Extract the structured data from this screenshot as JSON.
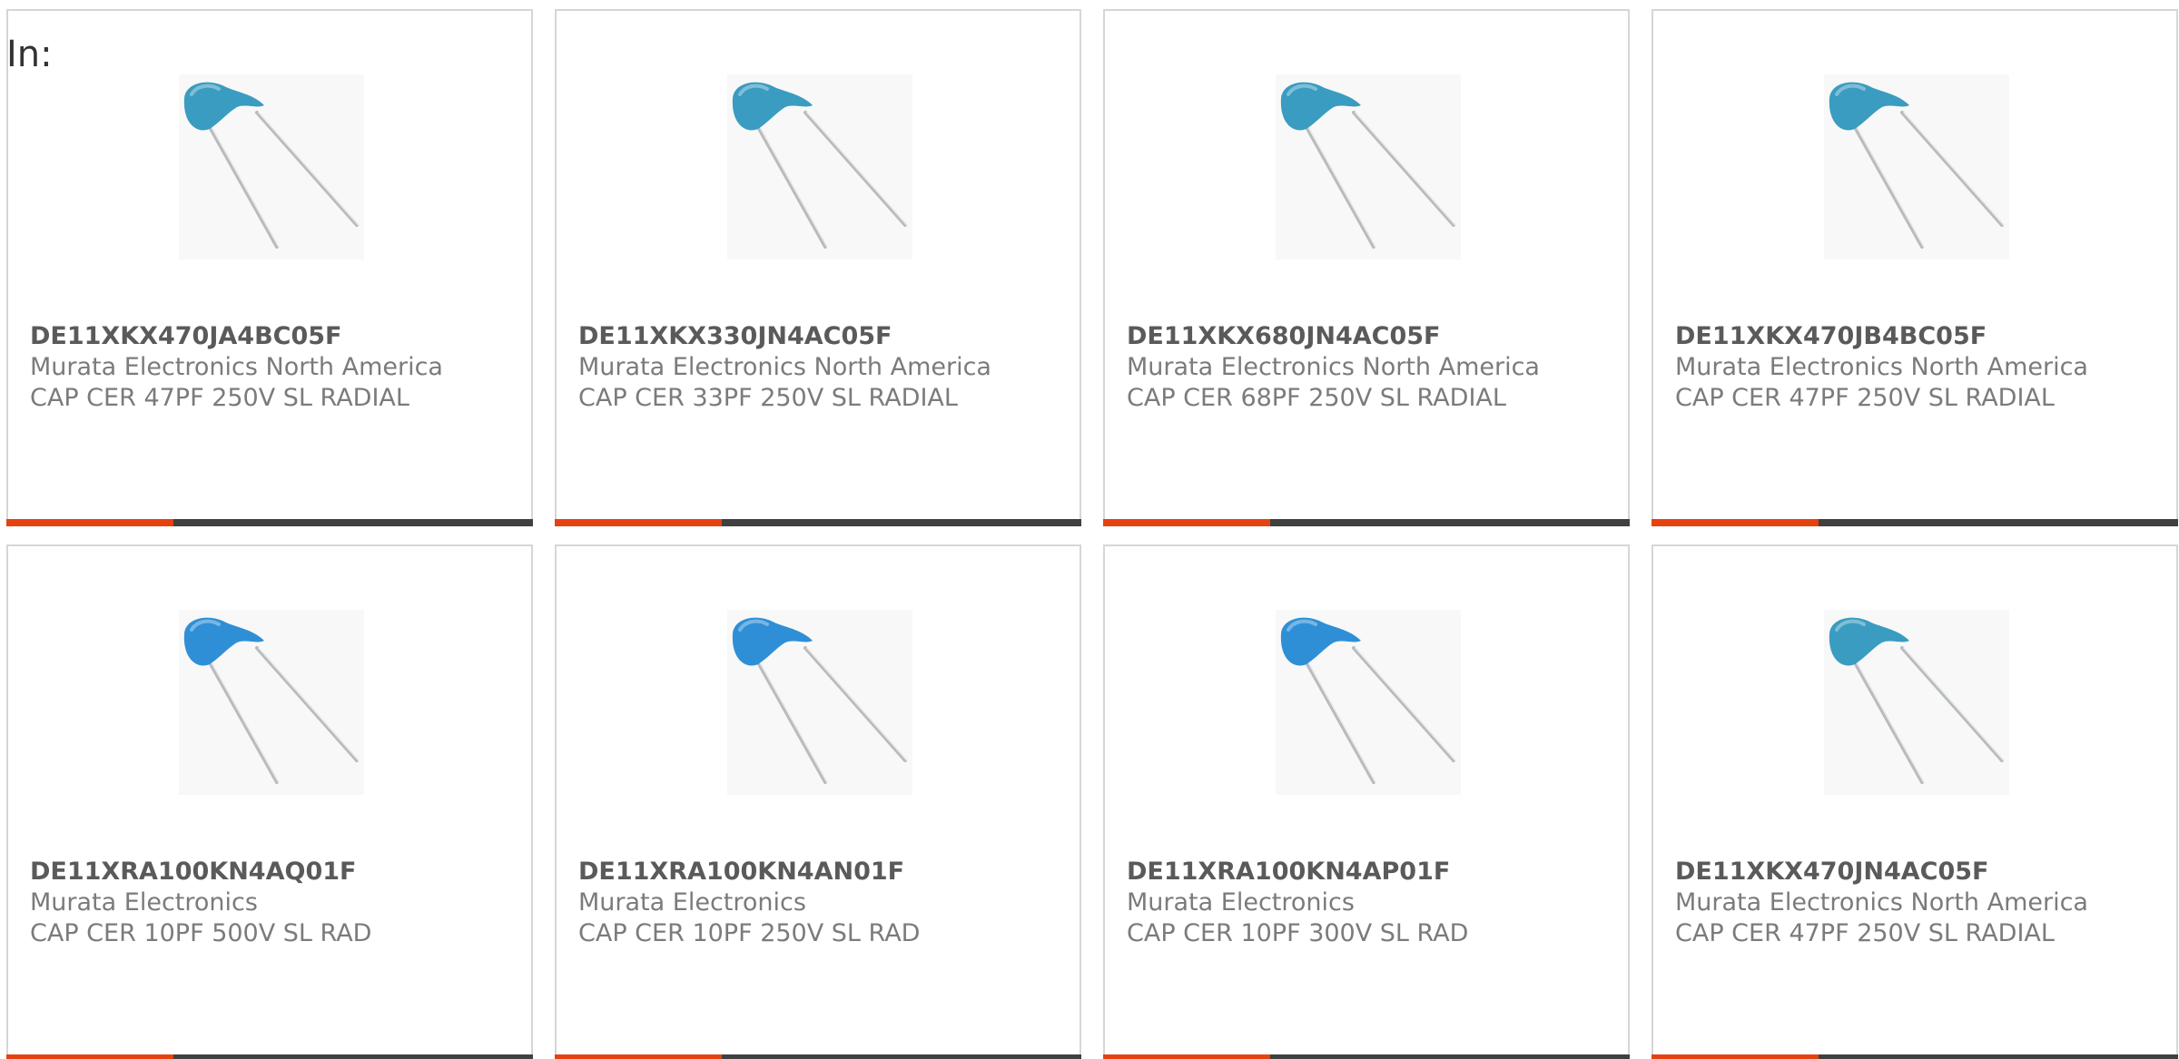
{
  "header": {
    "label": "In:"
  },
  "colors": {
    "accent": "#e5420f",
    "bar": "#404040",
    "capacitor_teal": "#3a9cc0",
    "capacitor_blue": "#2f8fd6"
  },
  "products": [
    {
      "part": "DE11XKX470JA4BC05F",
      "manufacturer": "Murata Electronics North America",
      "description": "CAP CER 47PF 250V SL RADIAL",
      "image_icon": "ceramic-capacitor-icon"
    },
    {
      "part": "DE11XKX330JN4AC05F",
      "manufacturer": "Murata Electronics North America",
      "description": "CAP CER 33PF 250V SL RADIAL",
      "image_icon": "ceramic-capacitor-icon"
    },
    {
      "part": "DE11XKX680JN4AC05F",
      "manufacturer": "Murata Electronics North America",
      "description": "CAP CER 68PF 250V SL RADIAL",
      "image_icon": "ceramic-capacitor-icon"
    },
    {
      "part": "DE11XKX470JB4BC05F",
      "manufacturer": "Murata Electronics North America",
      "description": "CAP CER 47PF 250V SL RADIAL",
      "image_icon": "ceramic-capacitor-icon"
    },
    {
      "part": "DE11XRA100KN4AQ01F",
      "manufacturer": "Murata Electronics",
      "description": "CAP CER 10PF 500V SL RAD",
      "image_icon": "ceramic-capacitor-icon"
    },
    {
      "part": "DE11XRA100KN4AN01F",
      "manufacturer": "Murata Electronics",
      "description": "CAP CER 10PF 250V SL RAD",
      "image_icon": "ceramic-capacitor-icon"
    },
    {
      "part": "DE11XRA100KN4AP01F",
      "manufacturer": "Murata Electronics",
      "description": "CAP CER 10PF 300V SL RAD",
      "image_icon": "ceramic-capacitor-icon"
    },
    {
      "part": "DE11XKX470JN4AC05F",
      "manufacturer": "Murata Electronics North America",
      "description": "CAP CER 47PF 250V SL RADIAL",
      "image_icon": "ceramic-capacitor-icon"
    }
  ]
}
